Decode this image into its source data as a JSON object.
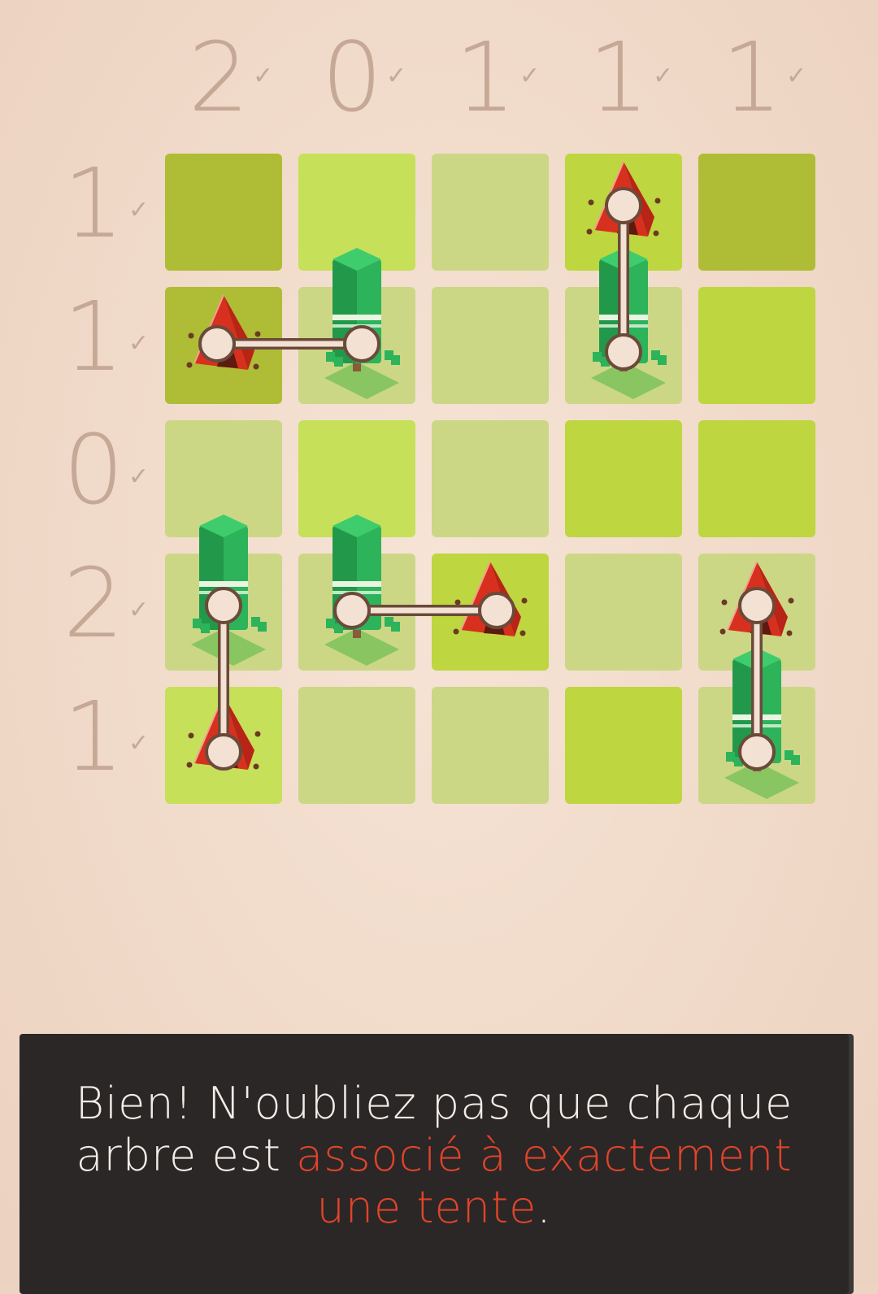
{
  "grid": {
    "rows": 5,
    "cols": 5,
    "col_clues": [
      "2",
      "0",
      "1",
      "1",
      "1"
    ],
    "row_clues": [
      "1",
      "1",
      "0",
      "2",
      "1"
    ],
    "cell_shades": [
      [
        "dark",
        "light",
        "pale",
        "mid",
        "dark"
      ],
      [
        "dark",
        "pale",
        "pale",
        "pale",
        "mid"
      ],
      [
        "pale",
        "light",
        "pale",
        "mid",
        "mid"
      ],
      [
        "pale",
        "pale",
        "mid",
        "pale",
        "pale"
      ],
      [
        "light",
        "pale",
        "pale",
        "mid",
        "pale"
      ]
    ],
    "trees": [
      [
        1,
        1
      ],
      [
        1,
        3
      ],
      [
        3,
        0
      ],
      [
        3,
        1
      ],
      [
        4,
        4
      ]
    ],
    "tents": [
      [
        0,
        3
      ],
      [
        1,
        0
      ],
      [
        3,
        2
      ],
      [
        3,
        4
      ],
      [
        4,
        0
      ]
    ],
    "links": [
      {
        "tree": [
          1,
          1
        ],
        "tent": [
          1,
          0
        ]
      },
      {
        "tree": [
          1,
          3
        ],
        "tent": [
          0,
          3
        ]
      },
      {
        "tree": [
          3,
          0
        ],
        "tent": [
          4,
          0
        ]
      },
      {
        "tree": [
          3,
          1
        ],
        "tent": [
          3,
          2
        ]
      },
      {
        "tree": [
          4,
          4
        ],
        "tent": [
          3,
          4
        ]
      }
    ]
  },
  "colors": {
    "dark": "#afbc35",
    "mid": "#bed63f",
    "light": "#c6e05a",
    "pale": "#ccd786",
    "clue": "#c6a896",
    "tent": "#d7301e",
    "tree": "#2db35a",
    "highlight": "#e0432b"
  },
  "icons": {
    "check": "checkmark-icon",
    "tree": "tree-icon",
    "tent": "tent-icon"
  },
  "tip": {
    "part1": "Bien! N'oubliez pas que chaque arbre est ",
    "highlight": "associé à exactement une tente",
    "end": "."
  }
}
